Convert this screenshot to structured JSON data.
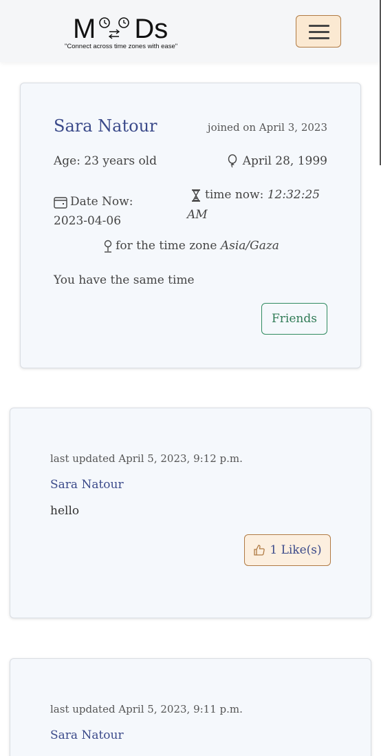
{
  "navbar": {
    "logo_text": "M  Ds",
    "logo_tagline": "\"Connect across time zones with ease\"",
    "menu_icon": "hamburger-icon"
  },
  "profile": {
    "name": "Sara Natour",
    "joined": "joined on April 3, 2023",
    "age": "Age: 23 years old",
    "birthday": "April 28, 1999",
    "date_now_label": "Date Now:",
    "date_now_value": "2023-04-06",
    "time_now_label": "time now:",
    "time_now_value": "12:32:25 AM",
    "timezone_label": "for the time zone",
    "timezone_value": "Asia/Gaza",
    "same_time": "You have the same time",
    "friends_button": "Friends"
  },
  "posts": [
    {
      "updated": "last updated April 5, 2023, 9:12 p.m.",
      "author": "Sara Natour",
      "body": "hello",
      "likes_label": "1 Like(s)"
    },
    {
      "updated": "last updated April 5, 2023, 9:11 p.m.",
      "author": "Sara Natour"
    }
  ],
  "colors": {
    "accent_name": "#3b4a8a",
    "friends_border": "#2f8a5f",
    "like_bg": "#fcefdf",
    "like_border": "#b07a43"
  }
}
